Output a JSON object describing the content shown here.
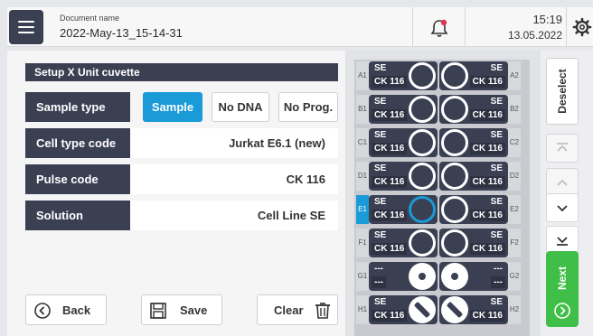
{
  "header": {
    "doc_label": "Document name",
    "doc_name": "2022-May-13_15-14-31",
    "time": "15:19",
    "date": "13.05.2022",
    "alert_color": "#e0334c"
  },
  "setup": {
    "title": "Setup X Unit cuvette",
    "sample_type_label": "Sample type",
    "sample_options": [
      "Sample",
      "No DNA",
      "No Prog."
    ],
    "selected_sample_option": "Sample",
    "cell_type_label": "Cell type code",
    "cell_type_value": "Jurkat E6.1 (new)",
    "pulse_label": "Pulse code",
    "pulse_value": "CK 116",
    "solution_label": "Solution",
    "solution_value": "Cell Line SE"
  },
  "footer": {
    "back": "Back",
    "save": "Save",
    "clear": "Clear"
  },
  "wells": [
    {
      "id": "A1",
      "line1": "SE",
      "line2": "CK 116",
      "selected": false,
      "state": "ring"
    },
    {
      "id": "A2",
      "line1": "SE",
      "line2": "CK 116",
      "selected": false,
      "state": "ring"
    },
    {
      "id": "B1",
      "line1": "SE",
      "line2": "CK 116",
      "selected": false,
      "state": "ring"
    },
    {
      "id": "B2",
      "line1": "SE",
      "line2": "CK 116",
      "selected": false,
      "state": "ring"
    },
    {
      "id": "C1",
      "line1": "SE",
      "line2": "CK 116",
      "selected": false,
      "state": "ring"
    },
    {
      "id": "C2",
      "line1": "SE",
      "line2": "CK 116",
      "selected": false,
      "state": "ring"
    },
    {
      "id": "D1",
      "line1": "SE",
      "line2": "CK 116",
      "selected": false,
      "state": "ring"
    },
    {
      "id": "D2",
      "line1": "SE",
      "line2": "CK 116",
      "selected": false,
      "state": "ring"
    },
    {
      "id": "E1",
      "line1": "SE",
      "line2": "CK 116",
      "selected": true,
      "state": "ring"
    },
    {
      "id": "E2",
      "line1": "SE",
      "line2": "CK 116",
      "selected": false,
      "state": "ring"
    },
    {
      "id": "F1",
      "line1": "SE",
      "line2": "CK 116",
      "selected": false,
      "state": "ring"
    },
    {
      "id": "F2",
      "line1": "SE",
      "line2": "CK 116",
      "selected": false,
      "state": "ring"
    },
    {
      "id": "G1",
      "line1": "---",
      "line2": "---",
      "selected": false,
      "state": "dot"
    },
    {
      "id": "G2",
      "line1": "---",
      "line2": "---",
      "selected": false,
      "state": "dot"
    },
    {
      "id": "H1",
      "line1": "SE",
      "line2": "CK 116",
      "selected": false,
      "state": "slash"
    },
    {
      "id": "H2",
      "line1": "SE",
      "line2": "CK 116",
      "selected": false,
      "state": "slash"
    }
  ],
  "rail": {
    "deselect": "Deselect",
    "next": "Next",
    "accent": "#3fbf47",
    "icons": [
      "double-up-icon",
      "up-icon",
      "down-icon",
      "double-down-icon"
    ]
  },
  "colors": {
    "primary_dark": "#3a3f52",
    "accent_blue": "#1a9ad6"
  }
}
